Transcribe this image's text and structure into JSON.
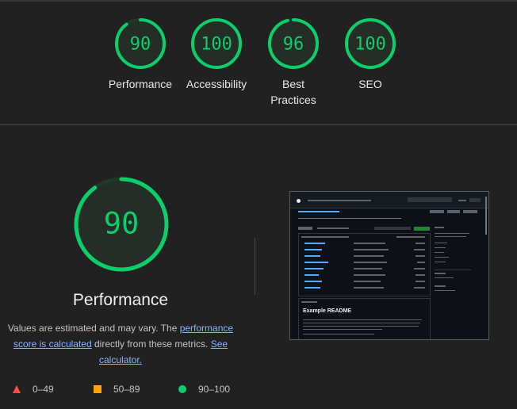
{
  "categories": [
    {
      "label": "Performance",
      "score": 90
    },
    {
      "label": "Accessibility",
      "score": 100
    },
    {
      "label": "Best\nPractices",
      "score": 96
    },
    {
      "label": "SEO",
      "score": 100
    }
  ],
  "main": {
    "score": 90,
    "title": "Performance",
    "desc_prefix": "Values are estimated and may vary. The ",
    "link1": "performance score is calculated",
    "desc_middle": " directly from these metrics. ",
    "link2": "See calculator."
  },
  "legend": [
    {
      "range": "0–49",
      "shape": "triangle",
      "color": "#ff4e42"
    },
    {
      "range": "50–89",
      "shape": "square",
      "color": "#ffa400"
    },
    {
      "range": "90–100",
      "shape": "circle",
      "color": "#0cce6b"
    }
  ],
  "screenshot": {
    "readme_title": "Example README"
  },
  "colors": {
    "pass": "#0cce6b",
    "background": "#212121",
    "link": "#8ab4f8"
  }
}
